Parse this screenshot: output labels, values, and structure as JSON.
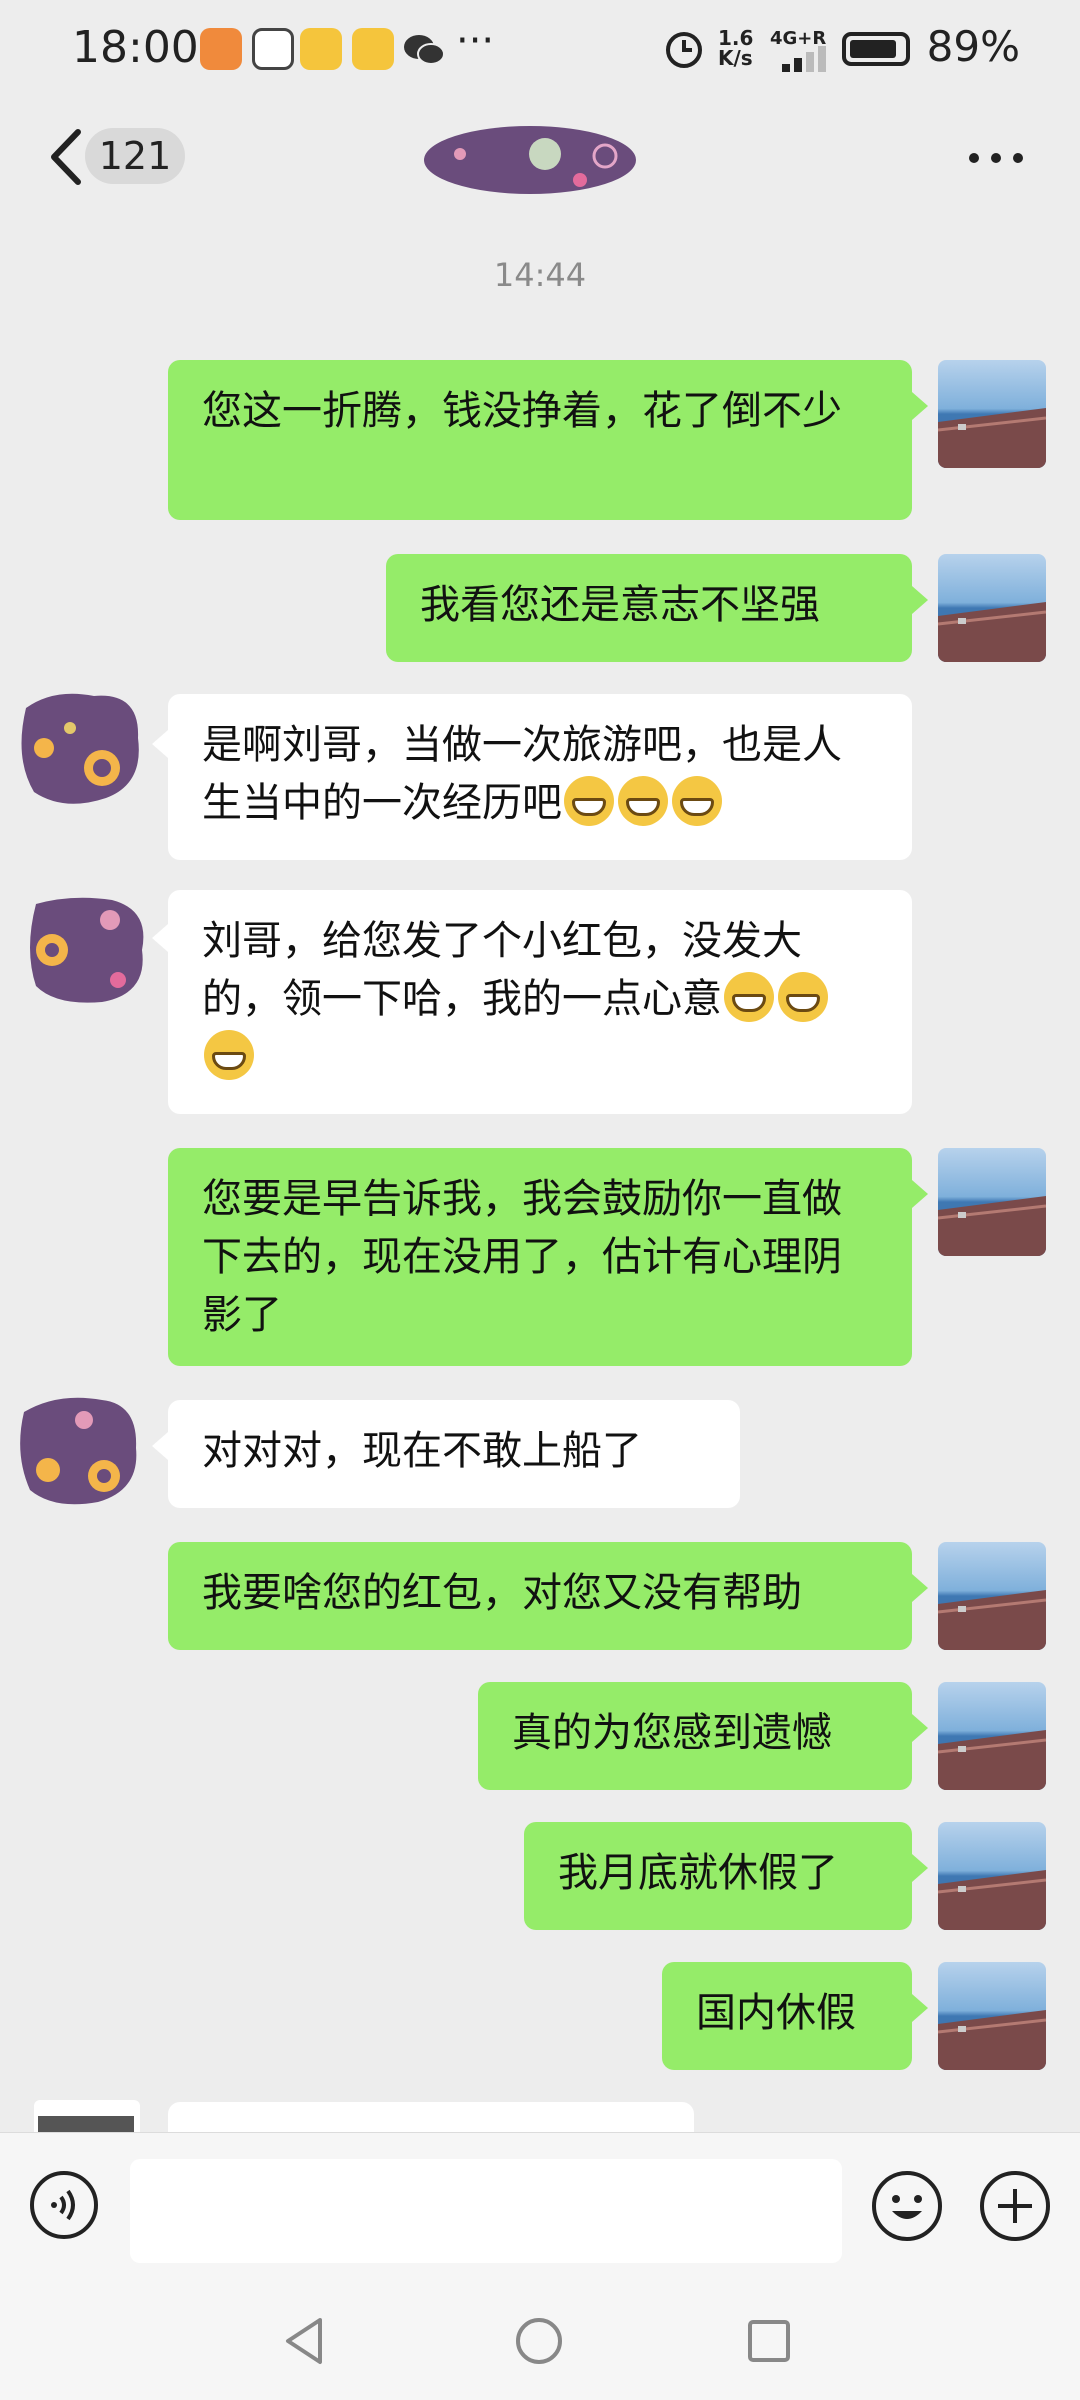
{
  "status_bar": {
    "time": "18:00",
    "net_speed": "1.6 K/s",
    "network": "4G+R",
    "battery_percent": "89%",
    "battery_level": 0.89
  },
  "header": {
    "unread_count": "121"
  },
  "chat": {
    "timestamp": "14:44",
    "messages": [
      {
        "from": "me",
        "text": "您这一折腾，钱没挣着，花了倒不少"
      },
      {
        "from": "me",
        "text": "我看您还是意志不坚强"
      },
      {
        "from": "them",
        "text": "是啊刘哥，当做一次旅游吧，也是人生当中的一次经历吧"
      },
      {
        "from": "them",
        "text": "刘哥，给您发了个小红包，没发大的，领一下哈，我的一点心意"
      },
      {
        "from": "me",
        "text": "您要是早告诉我，我会鼓励你一直做下去的，现在没用了，估计有心理阴影了"
      },
      {
        "from": "them",
        "text": "对对对，现在不敢上船了"
      },
      {
        "from": "me",
        "text": "我要啥您的红包，对您又没有帮助"
      },
      {
        "from": "me",
        "text": "真的为您感到遗憾"
      },
      {
        "from": "me",
        "text": "我月底就休假了"
      },
      {
        "from": "me",
        "text": "国内休假"
      }
    ]
  },
  "colors": {
    "my_bubble": "#95ec69",
    "their_bubble": "#ffffff",
    "background": "#ededed"
  }
}
